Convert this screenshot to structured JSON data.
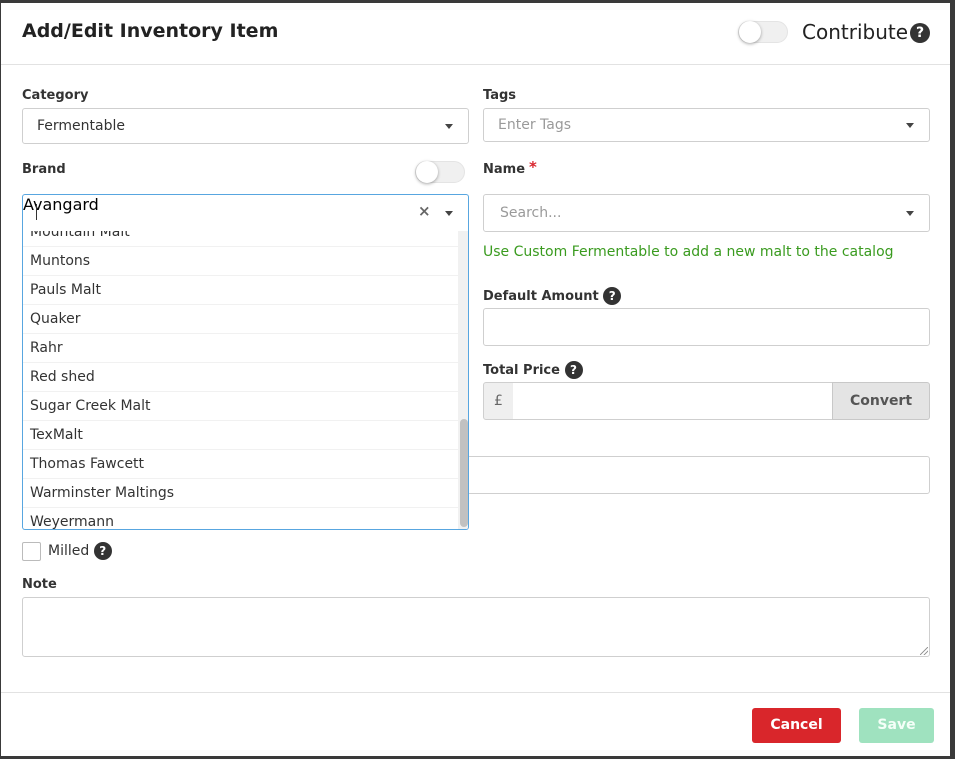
{
  "modal": {
    "title": "Add/Edit Inventory Item",
    "contribute_label": "Contribute",
    "help_glyph": "?"
  },
  "form": {
    "category": {
      "label": "Category",
      "value": "Fermentable"
    },
    "tags": {
      "label": "Tags",
      "placeholder": "Enter Tags"
    },
    "brand": {
      "label": "Brand",
      "placeholder": "Avangard",
      "clear_glyph": "×",
      "options": [
        "Mountain Malt",
        "Muntons",
        "Pauls Malt",
        "Quaker",
        "Rahr",
        "Red shed",
        "Sugar Creek Malt",
        "TexMalt",
        "Thomas Fawcett",
        "Warminster Maltings",
        "Weyermann"
      ]
    },
    "name": {
      "label": "Name",
      "required_mark": "*",
      "placeholder": "Search..."
    },
    "custom_hint": "Use Custom Fermentable to add a new malt to the catalog",
    "default_amount": {
      "label": "Default Amount",
      "value": ""
    },
    "total_price": {
      "label": "Total Price",
      "currency": "£",
      "value": "",
      "convert_label": "Convert"
    },
    "milled": {
      "label": "Milled",
      "checked": false
    },
    "note": {
      "label": "Note",
      "value": ""
    }
  },
  "footer": {
    "cancel_label": "Cancel",
    "save_label": "Save"
  },
  "colors": {
    "danger": "#d9262b",
    "success_disabled": "#9fe2bf",
    "hint": "#3a9b1f",
    "focus": "#58a6e0"
  },
  "icons": {
    "help": "question-circle-icon",
    "clear": "close-icon",
    "dropdown": "caret-down-icon"
  }
}
